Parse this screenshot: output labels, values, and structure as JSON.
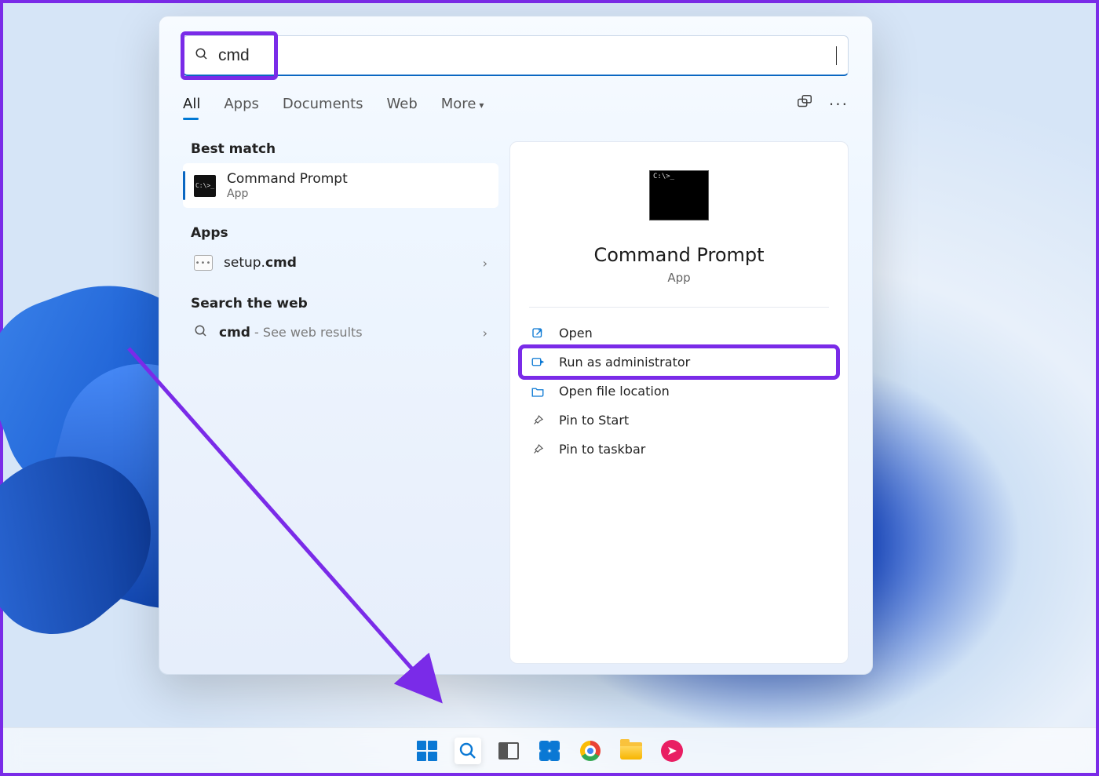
{
  "search": {
    "value": "cmd"
  },
  "tabs": {
    "items": [
      "All",
      "Apps",
      "Documents",
      "Web",
      "More"
    ],
    "active": "All"
  },
  "sections": {
    "best_match": "Best match",
    "apps": "Apps",
    "search_web": "Search the web"
  },
  "best_match_item": {
    "title": "Command Prompt",
    "subtitle": "App"
  },
  "apps_item": {
    "prefix": "setup.",
    "bold": "cmd"
  },
  "web_item": {
    "query": "cmd",
    "hint": " - See web results"
  },
  "preview": {
    "title": "Command Prompt",
    "subtitle": "App",
    "actions": {
      "open": "Open",
      "run_admin": "Run as administrator",
      "open_location": "Open file location",
      "pin_start": "Pin to Start",
      "pin_taskbar": "Pin to taskbar"
    }
  },
  "taskbar": {
    "items": [
      "start",
      "search",
      "taskview",
      "widgets",
      "chrome",
      "explorer",
      "chat"
    ]
  }
}
